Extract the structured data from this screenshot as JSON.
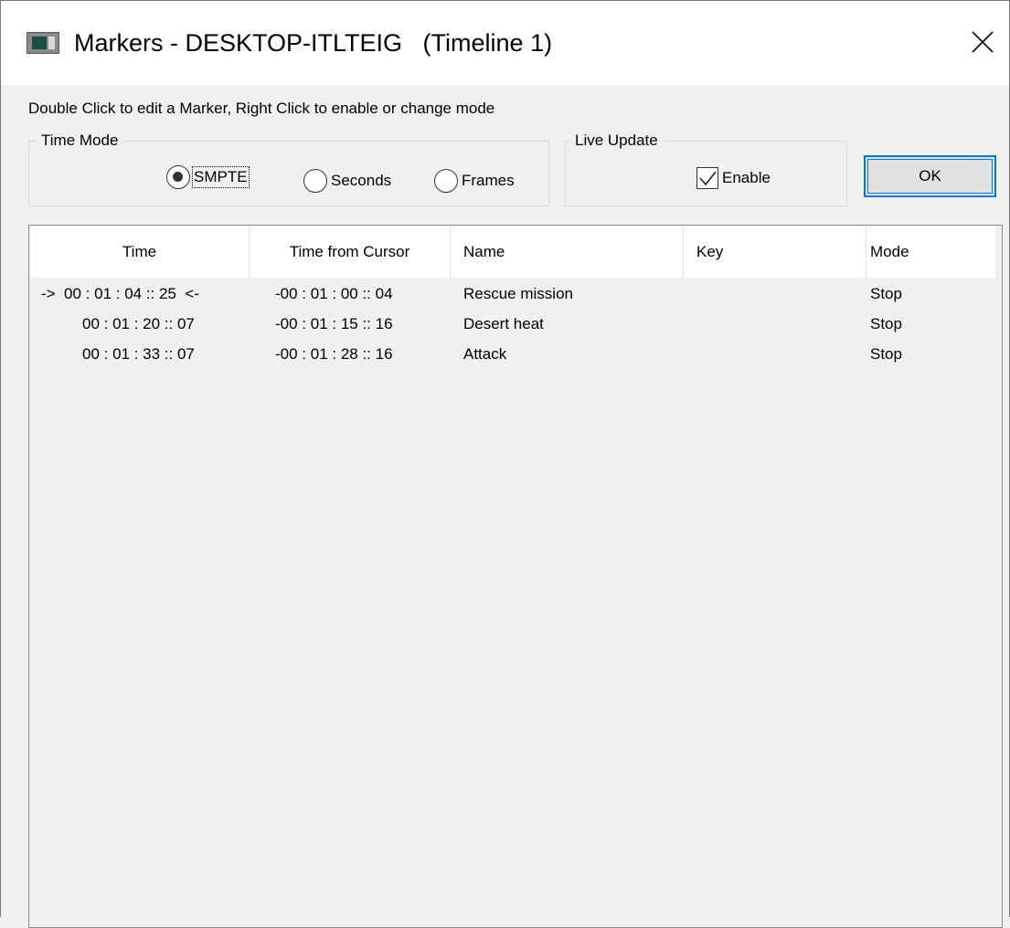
{
  "window": {
    "title": "Markers - DESKTOP-ITLTEIG   (Timeline 1)"
  },
  "hint": "Double Click to edit a Marker, Right Click to enable or change mode",
  "time_mode": {
    "legend": "Time Mode",
    "options": [
      "SMPTE",
      "Seconds",
      "Frames"
    ],
    "selected": "SMPTE"
  },
  "live_update": {
    "legend": "Live Update",
    "enable_label": "Enable",
    "enable_checked": true
  },
  "ok_label": "OK",
  "table": {
    "columns": [
      "Time",
      "Time from Cursor",
      "Name",
      "Key",
      "Mode"
    ],
    "rows": [
      {
        "time": "->  00 : 01 : 04 :: 25  <-",
        "from_cursor": "-00 : 01 : 00 :: 04",
        "name": "Rescue mission",
        "key": "",
        "mode": "Stop"
      },
      {
        "time": "00 : 01 : 20 :: 07",
        "from_cursor": "-00 : 01 : 15 :: 16",
        "name": "Desert heat",
        "key": "",
        "mode": "Stop"
      },
      {
        "time": "00 : 01 : 33 :: 07",
        "from_cursor": "-00 : 01 : 28 :: 16",
        "name": "Attack",
        "key": "",
        "mode": "Stop"
      }
    ]
  },
  "icons": {
    "app": "markers-window-icon",
    "close": "close-icon"
  }
}
